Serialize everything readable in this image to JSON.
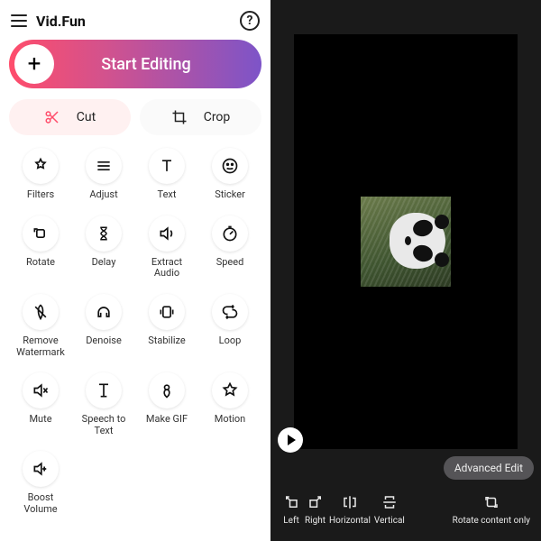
{
  "app": {
    "title": "Vid.Fun"
  },
  "header": {
    "help_tooltip": "?"
  },
  "start": {
    "label": "Start Editing"
  },
  "actions": {
    "cut": "Cut",
    "crop": "Crop"
  },
  "tools": [
    {
      "id": "filters",
      "label": "Filters"
    },
    {
      "id": "adjust",
      "label": "Adjust"
    },
    {
      "id": "text",
      "label": "Text"
    },
    {
      "id": "sticker",
      "label": "Sticker"
    },
    {
      "id": "rotate",
      "label": "Rotate"
    },
    {
      "id": "delay",
      "label": "Delay"
    },
    {
      "id": "extract-audio",
      "label": "Extract Audio"
    },
    {
      "id": "speed",
      "label": "Speed"
    },
    {
      "id": "remove-watermark",
      "label": "Remove Watermark"
    },
    {
      "id": "denoise",
      "label": "Denoise"
    },
    {
      "id": "stabilize",
      "label": "Stabilize"
    },
    {
      "id": "loop",
      "label": "Loop"
    },
    {
      "id": "mute",
      "label": "Mute"
    },
    {
      "id": "speech-to-text",
      "label": "Speech to Text"
    },
    {
      "id": "make-gif",
      "label": "Make GIF"
    },
    {
      "id": "motion",
      "label": "Motion"
    },
    {
      "id": "boost-volume",
      "label": "Boost Volume"
    }
  ],
  "right": {
    "advanced_edit": "Advanced Edit",
    "bottom_tools": {
      "left": "Left",
      "right": "Right",
      "horizontal": "Horizontal",
      "vertical": "Vertical",
      "rotate_content": "Rotate content only"
    }
  }
}
